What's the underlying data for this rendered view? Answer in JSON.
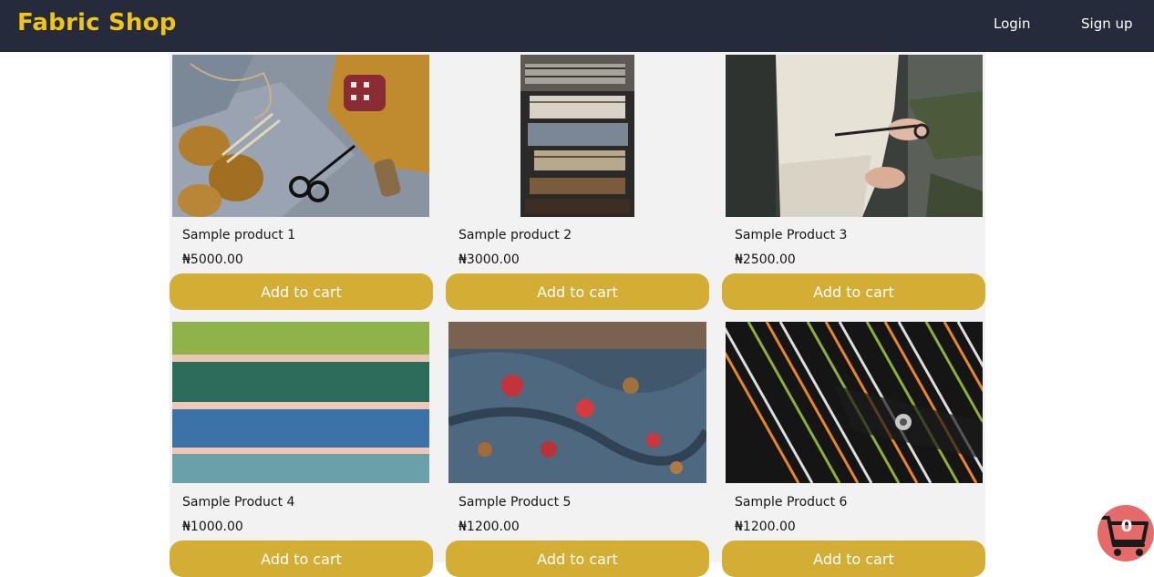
{
  "nav": {
    "brand": "Fabric Shop",
    "login": "Login",
    "signup": "Sign up"
  },
  "products": [
    {
      "name": "Sample product 1",
      "price": "₦5000.00",
      "button": "Add to cart",
      "image": "knitting-yarn-scissors"
    },
    {
      "name": "Sample product 2",
      "price": "₦3000.00",
      "button": "Add to cart",
      "image": "folded-plaid-fabrics"
    },
    {
      "name": "Sample Product 3",
      "price": "₦2500.00",
      "button": "Add to cart",
      "image": "cutting-fabric-scissors"
    },
    {
      "name": "Sample Product 4",
      "price": "₦1000.00",
      "button": "Add to cart",
      "image": "striped-green-blue-fabric"
    },
    {
      "name": "Sample Product 5",
      "price": "₦1200.00",
      "button": "Add to cart",
      "image": "floral-blue-silk"
    },
    {
      "name": "Sample Product 6",
      "price": "₦1200.00",
      "button": "Add to cart",
      "image": "black-striped-shirt"
    }
  ],
  "cart": {
    "count": "0"
  },
  "colors": {
    "navbar": "#252b3a",
    "brand": "#f0c419",
    "button": "#d4ad34",
    "cart_fab": "#e56b6b"
  }
}
